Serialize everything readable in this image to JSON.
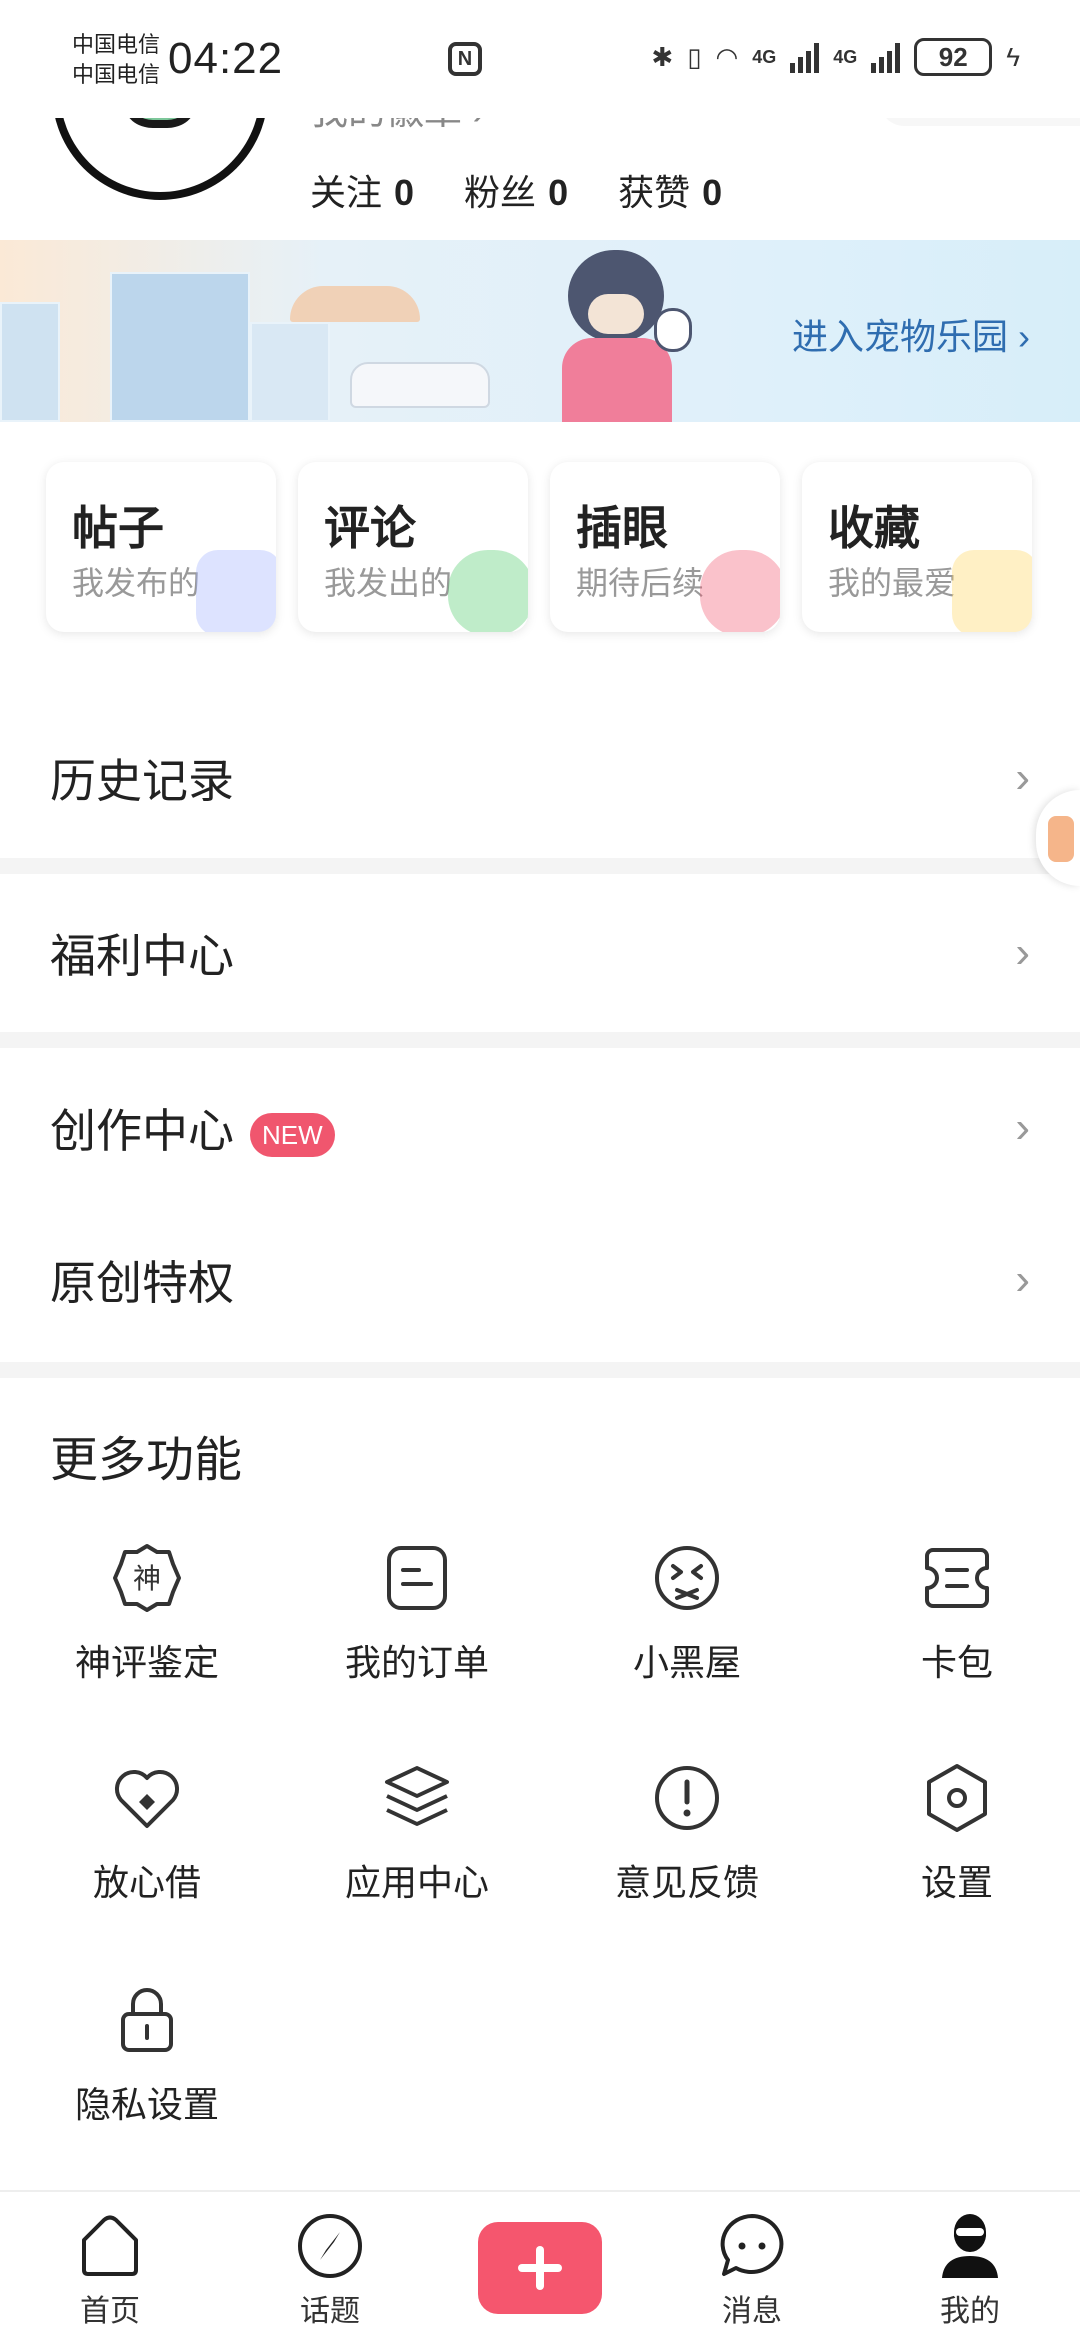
{
  "status_bar": {
    "carrier_1": "中国电信",
    "carrier_2": "中国电信",
    "time": "04:22",
    "network_1": "4G",
    "network_2": "4G",
    "battery": "92"
  },
  "profile": {
    "partial_text": "我的徽章 ›",
    "stats": [
      {
        "label": "关注",
        "value": "0"
      },
      {
        "label": "粉丝",
        "value": "0"
      },
      {
        "label": "获赞",
        "value": "0"
      }
    ]
  },
  "banner": {
    "link_text": "进入宠物乐园 ›"
  },
  "cards": [
    {
      "title": "帖子",
      "subtitle": "我发布的",
      "accent": "#c9d5ff"
    },
    {
      "title": "评论",
      "subtitle": "我发出的",
      "accent": "#7ddc8e"
    },
    {
      "title": "插眼",
      "subtitle": "期待后续",
      "accent": "#f7778c"
    },
    {
      "title": "收藏",
      "subtitle": "我的最爱",
      "accent": "#ffe08a"
    }
  ],
  "menu": {
    "history": "历史记录",
    "welfare": "福利中心",
    "creation": "创作中心",
    "creation_badge": "NEW",
    "original": "原创特权",
    "chevron": "›"
  },
  "more": {
    "title": "更多功能",
    "items": [
      {
        "label": "神评鉴定",
        "icon": "badge-icon"
      },
      {
        "label": "我的订单",
        "icon": "order-icon"
      },
      {
        "label": "小黑屋",
        "icon": "dizzy-face-icon"
      },
      {
        "label": "卡包",
        "icon": "card-wallet-icon"
      },
      {
        "label": "放心借",
        "icon": "heart-coin-icon"
      },
      {
        "label": "应用中心",
        "icon": "layers-icon"
      },
      {
        "label": "意见反馈",
        "icon": "exclamation-icon"
      },
      {
        "label": "设置",
        "icon": "hexagon-gear-icon"
      },
      {
        "label": "隐私设置",
        "icon": "lock-icon"
      }
    ],
    "badge_glyph": "神"
  },
  "nav": {
    "home": "首页",
    "topics": "话题",
    "messages": "消息",
    "mine": "我的"
  },
  "colors": {
    "accent": "#f5566e",
    "link": "#2f6db0"
  }
}
